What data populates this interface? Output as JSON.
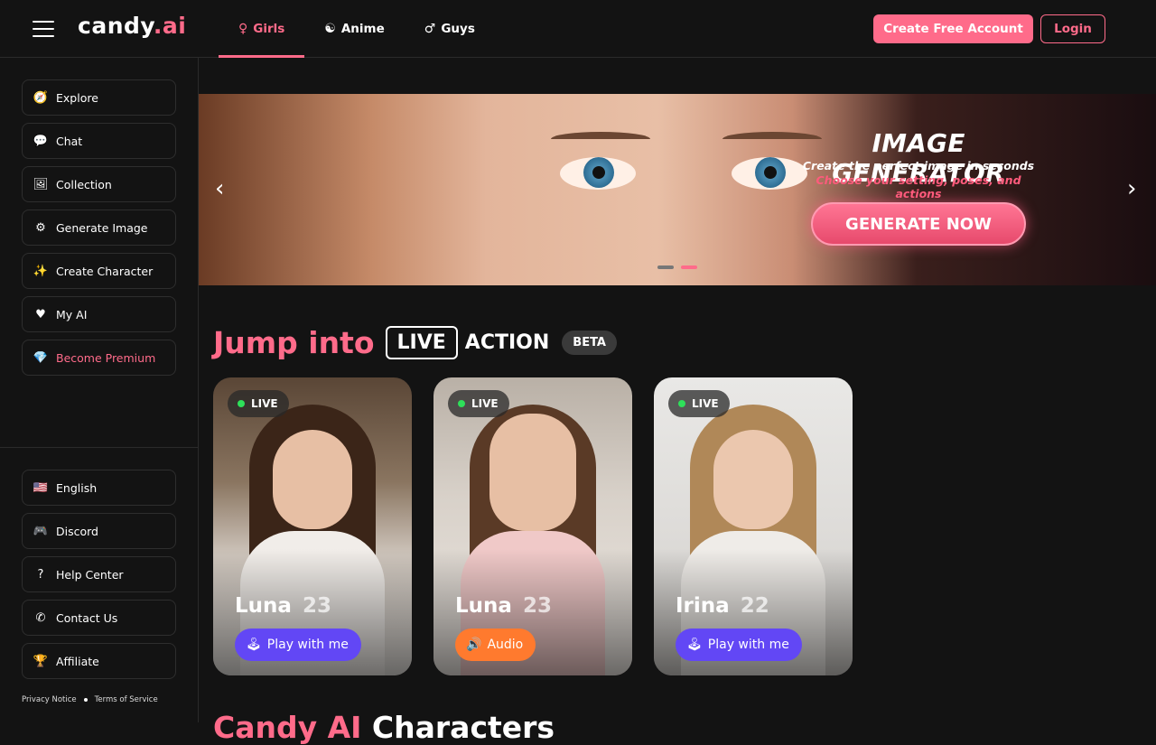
{
  "header": {
    "logo_main": "candy",
    "logo_ai": ".ai",
    "tabs": [
      {
        "label": "Girls",
        "icon": "♀"
      },
      {
        "label": "Anime",
        "icon": "☯"
      },
      {
        "label": "Guys",
        "icon": "♂"
      }
    ],
    "create_account": "Create Free Account",
    "login": "Login"
  },
  "sidebar": {
    "items": [
      {
        "label": "Explore",
        "icon": "🧭"
      },
      {
        "label": "Chat",
        "icon": "💬"
      },
      {
        "label": "Collection",
        "icon": "🖼"
      },
      {
        "label": "Generate Image",
        "icon": "⚙"
      },
      {
        "label": "Create Character",
        "icon": "✨"
      },
      {
        "label": "My AI",
        "icon": "♥"
      },
      {
        "label": "Become Premium",
        "icon": "💎"
      }
    ],
    "bottom_items": [
      {
        "label": "English",
        "icon": "🇺🇸"
      },
      {
        "label": "Discord",
        "icon": "🎮"
      },
      {
        "label": "Help Center",
        "icon": "?"
      },
      {
        "label": "Contact Us",
        "icon": "✆"
      },
      {
        "label": "Affiliate",
        "icon": "🏆"
      }
    ],
    "privacy": "Privacy Notice",
    "terms": "Terms of Service"
  },
  "banner": {
    "title": "IMAGE GENERATOR",
    "subtitle1": "Create the perfect image in seconds",
    "subtitle2": "Choose your setting, poses, and actions",
    "button": "GENERATE NOW",
    "prev": "‹",
    "next": "›"
  },
  "live_section": {
    "jump": "Jump into",
    "live": "LIVE",
    "action": "ACTION",
    "beta": "BETA"
  },
  "cards": [
    {
      "badge": "LIVE",
      "name": "Luna",
      "age": "23",
      "button": "Play with me",
      "button_icon": "🕹"
    },
    {
      "badge": "LIVE",
      "name": "Luna",
      "age": "23",
      "button": "Audio",
      "button_icon": "🔊"
    },
    {
      "badge": "LIVE",
      "name": "Irina",
      "age": "22",
      "button": "Play with me",
      "button_icon": "🕹"
    }
  ],
  "next_section": {
    "pink": "Candy AI",
    "white": "Characters"
  },
  "colors": {
    "accent": "#ff6b8a",
    "purple": "#6247f5",
    "orange": "#ff7a2e"
  }
}
